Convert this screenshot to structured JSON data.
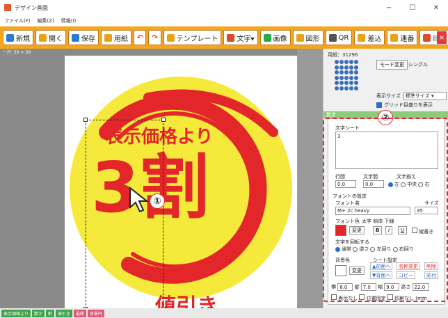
{
  "window": {
    "title": "デザイン画面",
    "controls": {
      "minimize": "−",
      "maximize": "☐",
      "close": "✕"
    }
  },
  "menu": [
    "ファイル(F)",
    "編集(Z)",
    "情報(I)"
  ],
  "toolbar": {
    "items": [
      {
        "label": "新規",
        "icon_color": "#2a7bd6"
      },
      {
        "label": "開く",
        "icon_color": "#e8a21a"
      },
      {
        "label": "保存",
        "icon_color": "#2a7bd6"
      },
      {
        "label": "用紙",
        "icon_color": "#e8a21a"
      },
      {
        "label": "",
        "icon_color": "#d94b2b"
      },
      {
        "label": "",
        "icon_color": "#d94b2b"
      },
      {
        "label": "テンプレート",
        "icon_color": "#e8a21a"
      },
      {
        "label": "文字▾",
        "icon_color": "#d94b2b"
      },
      {
        "label": "画像",
        "icon_color": "#2aa84a"
      },
      {
        "label": "図形",
        "icon_color": "#e8a21a"
      },
      {
        "label": "QR",
        "icon_color": "#555555"
      },
      {
        "label": "差込",
        "icon_color": "#e8a21a"
      },
      {
        "label": "連番",
        "icon_color": "#e8a21a"
      },
      {
        "label": "印刷",
        "icon_color": "#d94b2b"
      }
    ],
    "close": "×"
  },
  "canvas": {
    "ruler_text": "一片: 30   × 30",
    "labels": [
      "表示価格より",
      "3割",
      "値引き"
    ],
    "callout_1": "①",
    "callout_2": "②",
    "colors": {
      "yellow": "#f5ea3c",
      "red": "#e3262a",
      "canvas_bg": "#8a8a8a"
    }
  },
  "panel": {
    "paper_label": "用紙：31296",
    "mode_button": "モード変更",
    "mode_value": "シングル",
    "display_size_label": "表示サイズ",
    "display_size_value": "標準サイズ",
    "show_ruler_label": "グリッド目盛りを表示",
    "section_tab": "数字",
    "text_sheet_label": "文字シート",
    "text_sheet_value": "3",
    "line_spacing_label": "行間",
    "line_spacing_value": "0.0",
    "char_spacing_label": "文字間",
    "char_spacing_value": "0.0",
    "align_label": "文字揃え",
    "align_options": [
      "左",
      "中央",
      "右"
    ],
    "font_settings_label": "フォントの設定",
    "font_name_label": "フォント名",
    "font_name_value": "M+ 2c heavy",
    "size_label": "サイズ",
    "size_value": "35",
    "font_color_label": "フォント色",
    "style_labels": "太字  斜体  下線",
    "change_label": "変更",
    "bold": "B",
    "italic": "I",
    "underline": "U",
    "vertical_label": "縦書き",
    "rotate_label": "文字を回転する",
    "rotate_options": [
      "通常",
      "逆さ",
      "左回り",
      "右回り"
    ],
    "bg_color_label": "背景色",
    "bg_change": "変更",
    "sheet_settings_label": "シート設定",
    "to_front": "▲前面へ",
    "to_back": "▼背面へ",
    "rename": "名称変更",
    "copy": "コピー",
    "delete": "削除",
    "paste": "貼付",
    "pos_x_label": "横",
    "pos_x_value": "6.0",
    "pos_y_label": "縦",
    "pos_y_value": "7.0",
    "width_label": "幅",
    "width_value": "9.0",
    "height_label": "高さ",
    "height_value": "22.0",
    "hide_label": "表示なし",
    "lock_label": "位置固定",
    "noprint_label": "印刷なし",
    "unit": "(mm"
  },
  "status_chips": [
    {
      "label": "表示価格より",
      "color": "#3fa34d"
    },
    {
      "label": "数字",
      "color": "#3fa34d"
    },
    {
      "label": "割",
      "color": "#3fa34d"
    },
    {
      "label": "値引き",
      "color": "#3fa34d"
    },
    {
      "label": "最終",
      "color": "#e05a7a"
    },
    {
      "label": "背景円",
      "color": "#e05a7a"
    }
  ]
}
